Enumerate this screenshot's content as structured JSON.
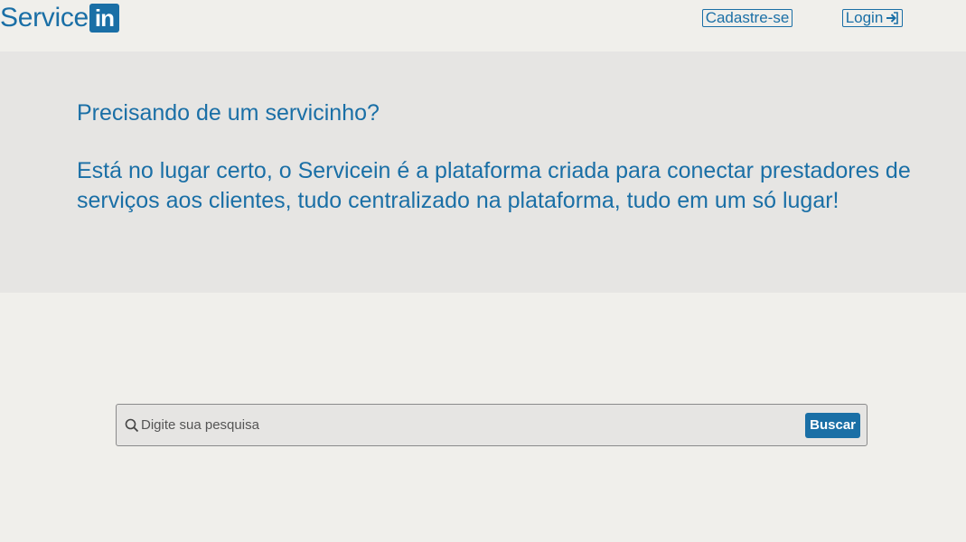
{
  "header": {
    "logo_text": "Service",
    "logo_badge": "in",
    "signup_label": "Cadastre-se",
    "login_label": "Login"
  },
  "hero": {
    "title": "Precisando de um servicinho?",
    "description": "Está no lugar certo, o Servicein é a plataforma criada para conectar prestadores de serviços aos clientes, tudo centralizado na plataforma, tudo em um só lugar!"
  },
  "search": {
    "placeholder": "Digite sua pesquisa",
    "value": "",
    "button_label": "Buscar"
  },
  "colors": {
    "brand": "#1a6fa6",
    "background": "#f0efeb",
    "hero_background": "#e6e5e3"
  },
  "icons": {
    "login": "sign-in-arrow-icon",
    "search": "magnifier-icon"
  }
}
